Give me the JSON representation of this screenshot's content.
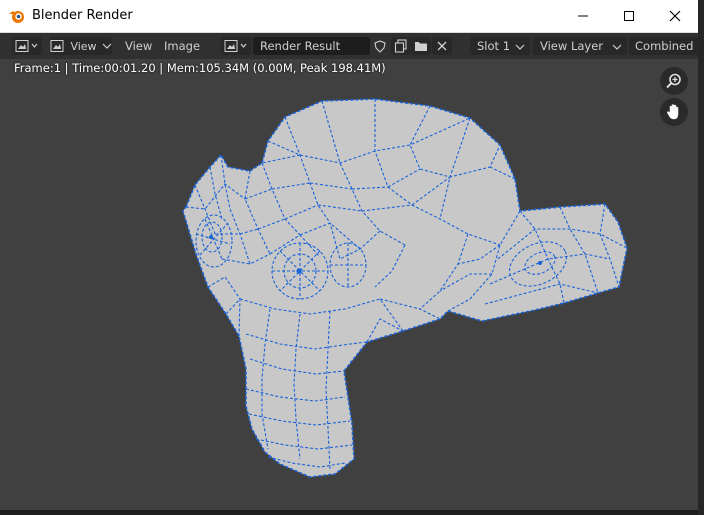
{
  "window": {
    "title": "Blender Render",
    "controls": [
      "minimize",
      "maximize",
      "close"
    ]
  },
  "header": {
    "editor_type_icon": "image-editor-icon",
    "view_mode_label": "View",
    "menus": [
      "View",
      "Image"
    ],
    "image_browse_icon": "image-browse-icon",
    "image_name": "Render Result",
    "slot": "Slot 1",
    "view_layer": "View Layer",
    "pass": "Combined"
  },
  "viewport": {
    "stats": "Frame:1 | Time:00:01.20 | Mem:105.34M (0.00M, Peak 198.41M)",
    "nav_buttons": [
      "zoom-icon",
      "pan-hand-icon"
    ]
  },
  "colors": {
    "background": "#404040",
    "header": "#303030",
    "mesh_fill": "#c8c8c8",
    "wire": "#1a63d8"
  }
}
